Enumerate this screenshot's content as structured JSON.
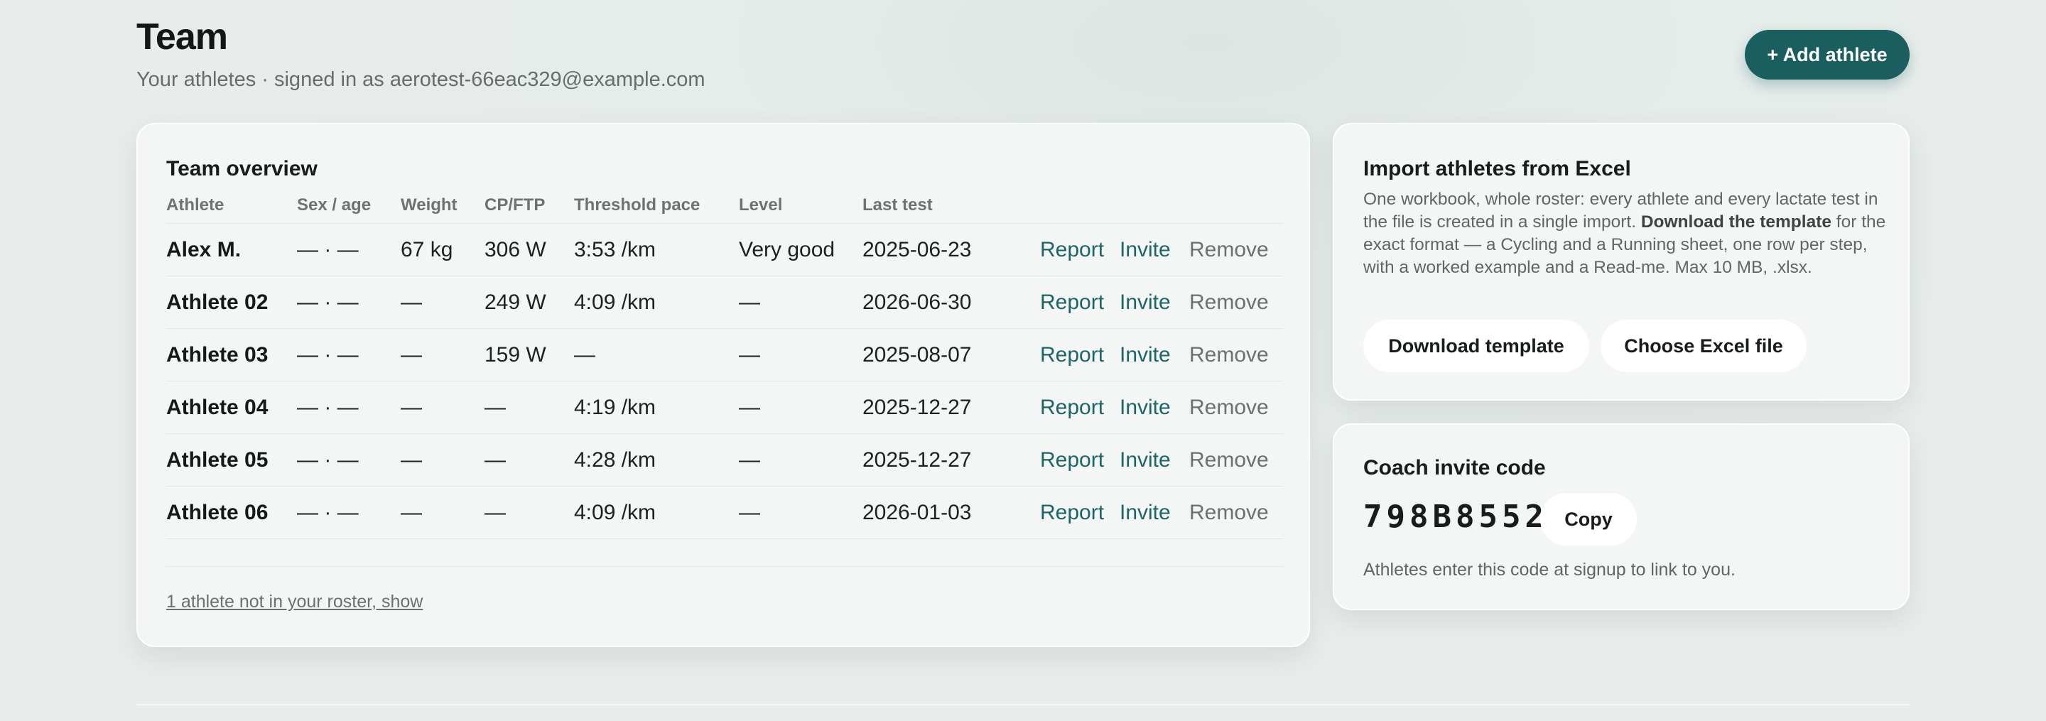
{
  "header": {
    "title": "Team",
    "subtitle": "Your athletes · signed in as aerotest-66eac329@example.com",
    "add_button": "+ Add athlete"
  },
  "team": {
    "title": "Team overview",
    "columns": [
      "Athlete",
      "Sex / age",
      "Weight",
      "CP/FTP",
      "Threshold pace",
      "Level",
      "Last test"
    ],
    "rows": [
      {
        "name": "Alex M.",
        "sex_age": "— · —",
        "weight": "67 kg",
        "cp": "306 W",
        "pace": "3:53 /km",
        "level": "Very good",
        "last_test": "2025-06-23",
        "report": "Report",
        "invite": "Invite",
        "remove": "Remove"
      },
      {
        "name": "Athlete 02",
        "sex_age": "— · —",
        "weight": "—",
        "cp": "249 W",
        "pace": "4:09 /km",
        "level": "—",
        "last_test": "2026-06-30",
        "report": "Report",
        "invite": "Invite",
        "remove": "Remove"
      },
      {
        "name": "Athlete 03",
        "sex_age": "— · —",
        "weight": "—",
        "cp": "159 W",
        "pace": "—",
        "level": "—",
        "last_test": "2025-08-07",
        "report": "Report",
        "invite": "Invite",
        "remove": "Remove"
      },
      {
        "name": "Athlete 04",
        "sex_age": "— · —",
        "weight": "—",
        "cp": "—",
        "pace": "4:19 /km",
        "level": "—",
        "last_test": "2025-12-27",
        "report": "Report",
        "invite": "Invite",
        "remove": "Remove"
      },
      {
        "name": "Athlete 05",
        "sex_age": "— · —",
        "weight": "—",
        "cp": "—",
        "pace": "4:28 /km",
        "level": "—",
        "last_test": "2025-12-27",
        "report": "Report",
        "invite": "Invite",
        "remove": "Remove"
      },
      {
        "name": "Athlete 06",
        "sex_age": "— · —",
        "weight": "—",
        "cp": "—",
        "pace": "4:09 /km",
        "level": "—",
        "last_test": "2026-01-03",
        "report": "Report",
        "invite": "Invite",
        "remove": "Remove"
      }
    ],
    "roster_link": "1 athlete not in your roster, show"
  },
  "import": {
    "title": "Import athletes from Excel",
    "desc_before": "One workbook, whole roster: every athlete and every lactate test in the file is created in a single import. ",
    "desc_bold": "Download the template",
    "desc_after": " for the exact format — a Cycling and a Running sheet, one row per step, with a worked example and a Read-me. Max 10 MB, .xlsx.",
    "download_button": "Download template",
    "choose_button": "Choose Excel file"
  },
  "invite": {
    "title": "Coach invite code",
    "code": "798B8552",
    "copy_button": "Copy",
    "note": "Athletes enter this code at signup to link to you."
  },
  "colors": {
    "accent": "#1a5e60",
    "link": "#1d6466",
    "muted": "#6a716e",
    "background": "#e8edeb",
    "card": "#f4f6f5"
  }
}
